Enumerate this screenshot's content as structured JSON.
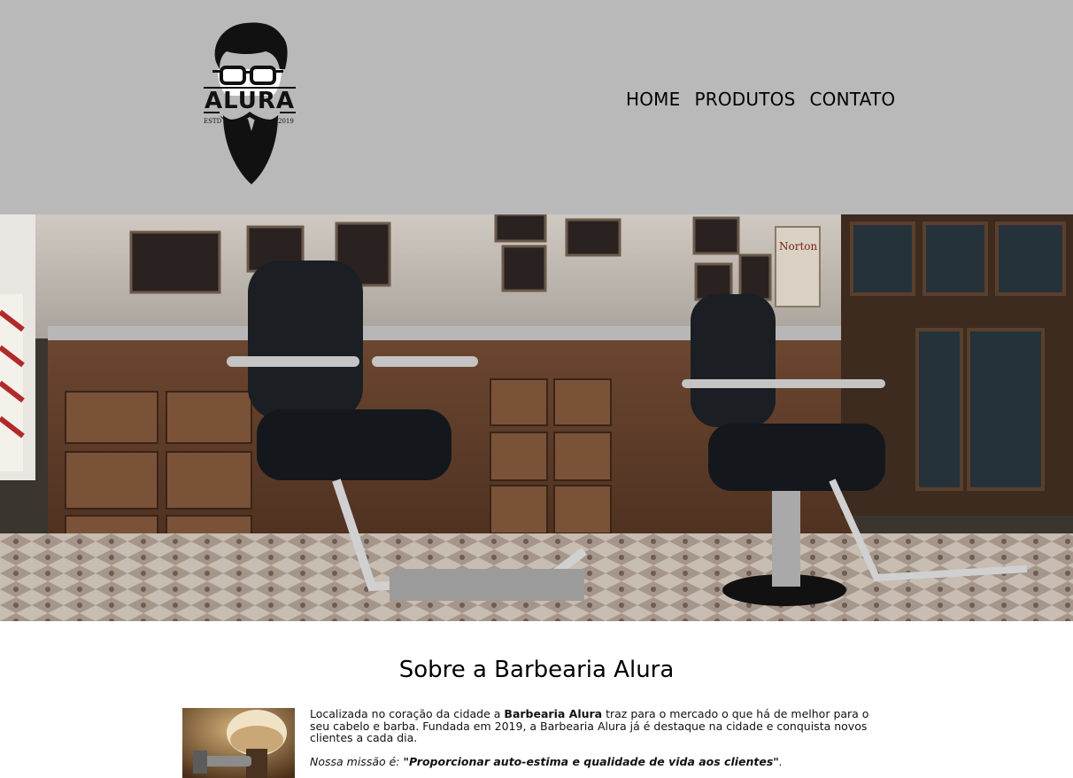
{
  "header": {
    "logo": {
      "icon": "bearded-man-with-glasses-logo",
      "brand": "ALURA",
      "left_text": "ESTD",
      "right_text": "2019"
    },
    "nav": [
      {
        "label": "HOME"
      },
      {
        "label": "PRODUTOS"
      },
      {
        "label": "CONTATO"
      }
    ]
  },
  "banner": {
    "image": "barbershop-interior-photo",
    "sign_text": "Norton"
  },
  "main": {
    "title": "Sobre a Barbearia Alura",
    "image": "shaving-brush-and-razor-photo",
    "paragraph1": {
      "before": "Localizada no coração da cidade a ",
      "strong": "Barbearia Alura",
      "after": " traz para o mercado o que há de melhor para o seu cabelo e barba. Fundada em 2019, a Barbearia Alura já é destaque na cidade e conquista novos clientes a cada dia."
    },
    "paragraph2": {
      "label": "Nossa missão é: ",
      "quote": "\"Proporcionar auto-estima e qualidade de vida aos clientes\"",
      "end": "."
    }
  },
  "colors": {
    "header_bg": "#b9b9b9",
    "text": "#000000"
  }
}
